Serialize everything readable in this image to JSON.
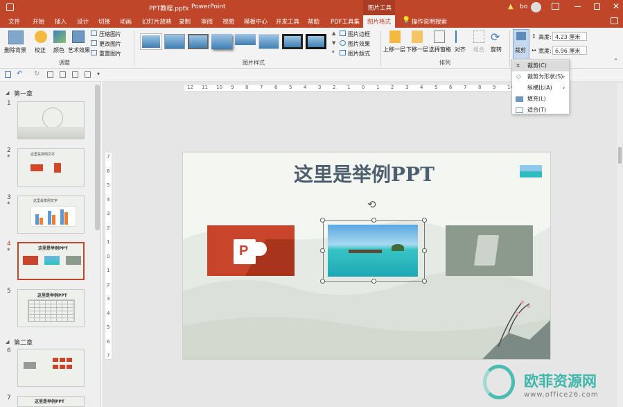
{
  "title": {
    "doc_name": "PPT教程.pptx",
    "separator": "-",
    "app_name": "PowerPoint",
    "context_tab": "图片工具",
    "user": "bo",
    "warn_icon": "warning-icon"
  },
  "tabs": [
    "文件",
    "开始",
    "插入",
    "设计",
    "切换",
    "动画",
    "幻灯片放映",
    "录制",
    "审阅",
    "视图",
    "模板中心",
    "开发工具",
    "帮助",
    "PDF工具集",
    "图片格式"
  ],
  "tell_me": "操作说明搜索",
  "ribbon": {
    "adjust": {
      "remove_bg": "删除背景",
      "corrections": "校正",
      "color": "颜色",
      "artistic": "艺术效果",
      "compress": "压缩图片",
      "change": "更改图片",
      "reset": "重置图片",
      "group_label": "调整"
    },
    "styles": {
      "border": "图片边框",
      "effects": "图片效果",
      "layout": "图片版式",
      "group_label": "图片样式"
    },
    "arrange": {
      "forward": "上移一层",
      "backward": "下移一层",
      "selection": "选择窗格",
      "align": "对齐",
      "group": "组合",
      "rotate": "旋转",
      "group_label": "排列"
    },
    "size": {
      "crop": "裁剪",
      "height_label": "高度:",
      "height_value": "4.23 厘米",
      "width_label": "宽度:",
      "width_value": "6.96 厘米"
    }
  },
  "crop_menu": [
    {
      "label": "裁剪(C)",
      "arrow": ""
    },
    {
      "label": "裁剪为形状(S)",
      "arrow": "›"
    },
    {
      "label": "纵横比(A)",
      "arrow": "›"
    },
    {
      "label": "填充(L)",
      "arrow": ""
    },
    {
      "label": "适合(T)",
      "arrow": ""
    }
  ],
  "sections": [
    "第一章",
    "第二章"
  ],
  "slides": [
    {
      "num": "1",
      "star": "",
      "title": ""
    },
    {
      "num": "2",
      "star": "*",
      "title": "这里是举例文字"
    },
    {
      "num": "3",
      "star": "*",
      "title": "这里是举例文字"
    },
    {
      "num": "4",
      "star": "*",
      "title": "这里是举例PPT"
    },
    {
      "num": "5",
      "star": "",
      "title": "这里是举例PPT"
    },
    {
      "num": "6",
      "star": "",
      "title": ""
    },
    {
      "num": "7",
      "star": "",
      "title": "这里是举例PPT"
    }
  ],
  "ruler": {
    "h_ticks": [
      "12",
      "11",
      "10",
      "9",
      "8",
      "7",
      "6",
      "5",
      "4",
      "3",
      "2",
      "1",
      "0",
      "1",
      "2",
      "3",
      "4",
      "5",
      "6",
      "7",
      "8",
      "9",
      "10",
      "11",
      "12"
    ],
    "v_ticks": [
      "7",
      "6",
      "5",
      "4",
      "3",
      "2",
      "1",
      "0",
      "1",
      "2",
      "3",
      "4",
      "5",
      "6",
      "7"
    ]
  },
  "slide": {
    "title": "这里是举例PPT",
    "ppt_letter": "P"
  },
  "watermark": {
    "brand": "欧菲资源网",
    "url": "www.office26.com"
  }
}
